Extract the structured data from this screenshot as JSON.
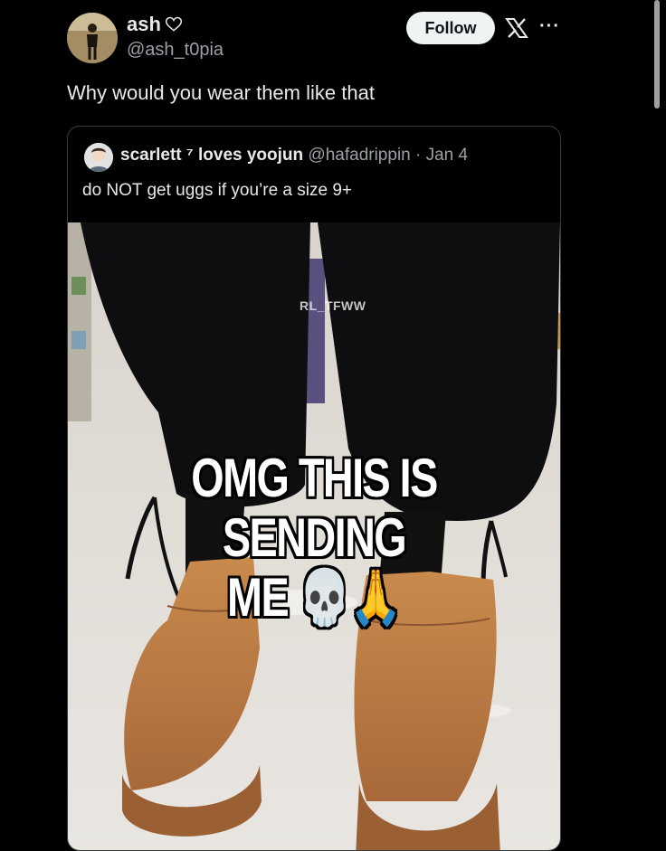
{
  "post": {
    "display_name": "ash",
    "handle": "@ash_t0pia",
    "follow_label": "Follow",
    "text": "Why would you wear them like that"
  },
  "quoted": {
    "name": "scarlett ⁷ loves yoojun",
    "handle_date": "@hafadrippin · Jan 4",
    "text": "do NOT get uggs if you’re a size 9+"
  },
  "media": {
    "watermark": "RL_TFWW",
    "caption_line1": "OMG THIS IS SENDING",
    "caption_line2": "ME 💀🙏"
  },
  "icons": {
    "heart": "heart-outline-icon",
    "more": "more-dots-icon",
    "logo": "x-logo-icon"
  }
}
